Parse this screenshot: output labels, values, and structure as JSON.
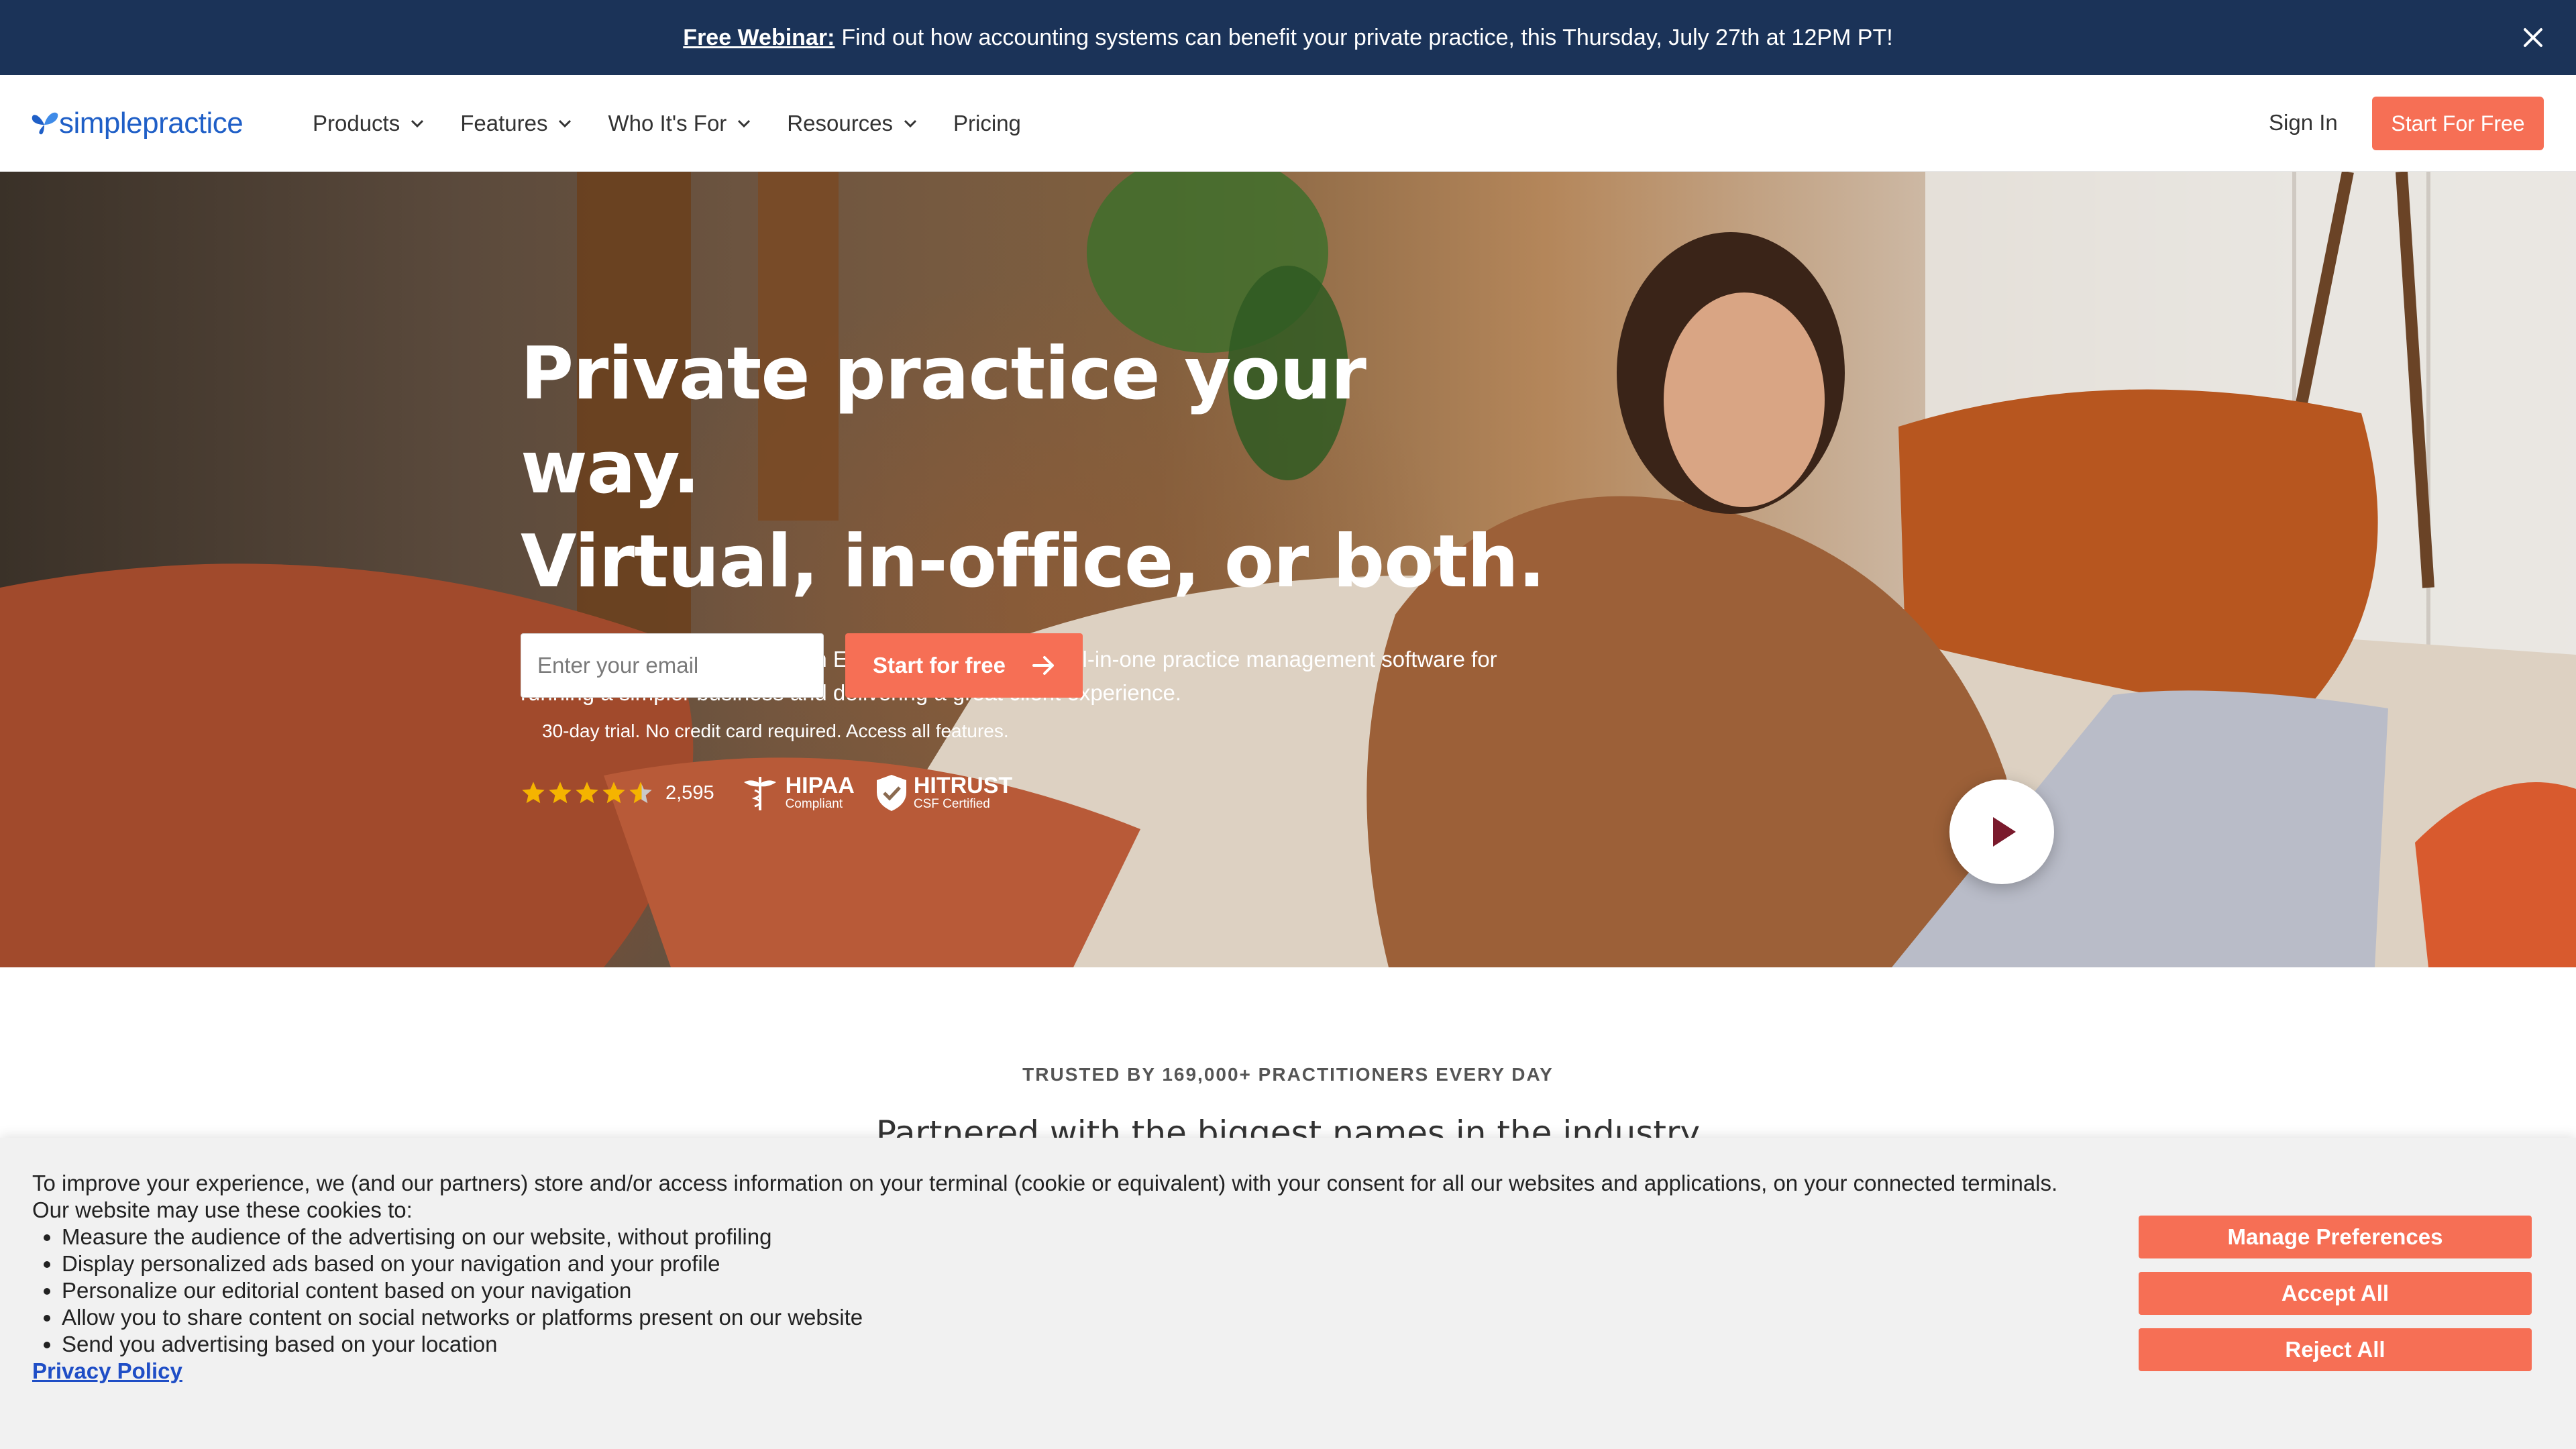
{
  "announcement": {
    "link_text": "Free Webinar:",
    "message": "Find out how accounting systems can benefit your private practice, this Thursday, July 27th at 12PM PT!"
  },
  "nav": {
    "logo_text": "simplepractice",
    "items": [
      {
        "label": "Products",
        "dropdown": true
      },
      {
        "label": "Features",
        "dropdown": true
      },
      {
        "label": "Who It's For",
        "dropdown": true
      },
      {
        "label": "Resources",
        "dropdown": true
      },
      {
        "label": "Pricing",
        "dropdown": false
      }
    ],
    "sign_in": "Sign In",
    "cta": "Start For Free"
  },
  "hero": {
    "title_line1": "Private practice your way.",
    "title_line2": "Virtual, in-office, or both.",
    "subtitle": "SimplePractice is more than an EHR software. It’s your all-in-one practice management software for running a simpler business and delivering a great client experience.",
    "email_placeholder": "Enter your email",
    "cta": "Start for free",
    "trial_note": "30-day trial. No credit card required. Access all features.",
    "rating": 4.5,
    "rating_count": "2,595",
    "hipaa_title": "HIPAA",
    "hipaa_sub": "Compliant",
    "hitrust_title": "HITRUST",
    "hitrust_sub": "CSF Certified"
  },
  "trusted": {
    "label": "TRUSTED BY 169,000+ PRACTITIONERS EVERY DAY",
    "headline": "Partnered with the biggest names in the industry"
  },
  "cookie": {
    "intro": "To improve your experience, we (and our partners) store and/or access information on your terminal (cookie or equivalent) with your consent for all our websites and applications, on your connected terminals.",
    "uses_label": "Our website may use these cookies to:",
    "uses": [
      "Measure the audience of the advertising on our website, without profiling",
      "Display personalized ads based on your navigation and your profile",
      "Personalize our editorial content based on your navigation",
      "Allow you to share content on social networks or platforms present on our website",
      "Send you advertising based on your location"
    ],
    "privacy_link": "Privacy Policy",
    "manage": "Manage Preferences",
    "accept": "Accept All",
    "reject": "Reject All"
  },
  "colors": {
    "announcement_bg": "#1b3358",
    "brand_blue": "#1f5fc7",
    "accent_coral": "#f66f55",
    "star_gold": "#f5b400",
    "cookie_bg": "#f1f1f1"
  },
  "icons": {
    "close": "close-icon",
    "chevron": "chevron-down-icon",
    "arrow": "arrow-right-icon",
    "play": "play-icon",
    "star": "star-icon",
    "caduceus": "caduceus-icon",
    "shield": "shield-check-icon",
    "logo": "butterfly-logo-icon"
  }
}
